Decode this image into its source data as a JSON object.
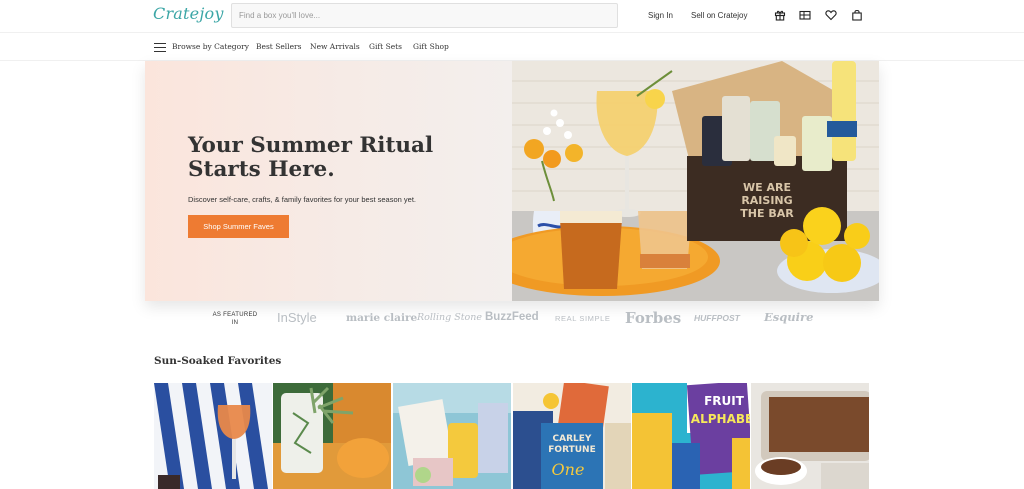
{
  "header": {
    "logo": "Cratejoy",
    "search_placeholder": "Find a box you'll love...",
    "sign_in": "Sign In",
    "sell": "Sell on Cratejoy",
    "icons": [
      "gift-icon",
      "gift-card-icon",
      "heart-icon",
      "bag-icon"
    ]
  },
  "nav": {
    "browse": "Browse by Category",
    "items": [
      "Best Sellers",
      "New Arrivals",
      "Gift Sets",
      "Gift Shop"
    ]
  },
  "hero": {
    "title": "Your Summer Ritual Starts Here.",
    "subtitle": "Discover self-care, crafts, & family favorites for your best season yet.",
    "button": "Shop Summer Faves",
    "box_text": "WE ARE RAISING THE BAR"
  },
  "featured": {
    "label": "AS FEATURED IN",
    "publications": [
      "InStyle",
      "marie claire",
      "Rolling Stone",
      "BuzzFeed",
      "REAL SIMPLE",
      "Forbes",
      "HUFFPOST",
      "Esquire"
    ]
  },
  "section": {
    "title": "Sun-Soaked Favorites",
    "tiles": [
      "striped-drink-tile",
      "plant-tile",
      "gift-box-tile",
      "books-tile",
      "fruit-alphabet-tile",
      "brownie-tile"
    ],
    "tile_texts": {
      "books_line1": "CARLEY",
      "books_line2": "FORTUNE",
      "books_line3": "One",
      "fruit_line1": "FRUIT",
      "fruit_line2": "ALPHABE"
    }
  },
  "colors": {
    "accent": "#ee7b32",
    "logo": "#3ba6a6",
    "hero_bg": "#fbe5dc"
  }
}
